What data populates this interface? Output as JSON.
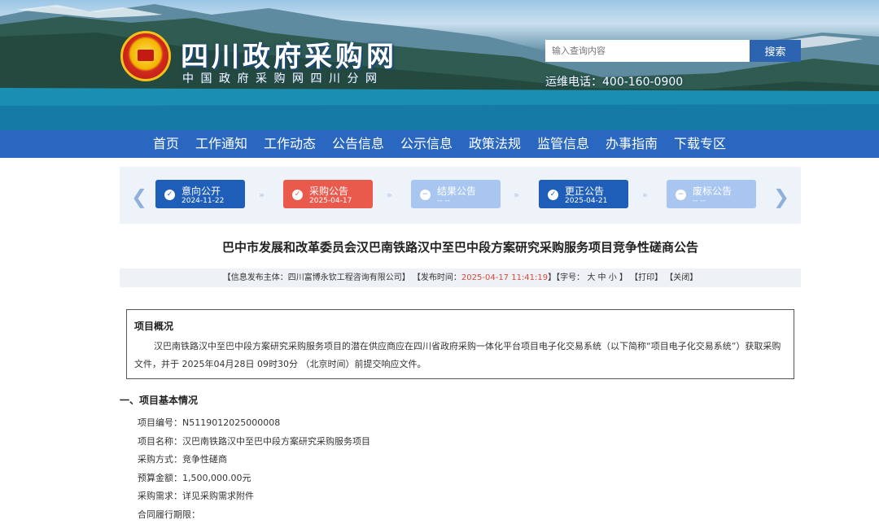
{
  "header": {
    "title": "四川政府采购网",
    "subtitle": "中国政府采购网四川分网",
    "search_placeholder": "输入查询内容",
    "search_button": "搜索",
    "hotline": "运维电话：400-160-0900"
  },
  "nav": {
    "items": [
      "首页",
      "工作通知",
      "工作动态",
      "公告信息",
      "公示信息",
      "政策法规",
      "监管信息",
      "办事指南",
      "下载专区"
    ]
  },
  "timeline": {
    "steps": [
      {
        "label": "意向公开",
        "date": "2024-11-22",
        "state": "done",
        "color": "#1f5eb8",
        "icon": "check-icon"
      },
      {
        "label": "采购公告",
        "date": "2025-04-17",
        "state": "current",
        "color": "#ea5a4c",
        "icon": "check-icon"
      },
      {
        "label": "结果公告",
        "date": "-- --",
        "state": "pending",
        "color": "#a8c6f0",
        "icon": "minus-icon"
      },
      {
        "label": "更正公告",
        "date": "2025-04-21",
        "state": "done",
        "color": "#1f5eb8",
        "icon": "check-icon"
      },
      {
        "label": "废标公告",
        "date": "-- --",
        "state": "pending",
        "color": "#a8c6f0",
        "icon": "minus-icon"
      }
    ]
  },
  "article": {
    "title": "巴中市发展和改革委员会汉巴南铁路汉中至巴中段方案研究采购服务项目竞争性磋商公告",
    "meta": {
      "publisher_label": "【信息发布主体：",
      "publisher": "四川富博永钦工程咨询有限公司】",
      "time_label": "【发布时间：",
      "time": "2025-04-17 11:41:19",
      "time_end": "】",
      "font_label": "【字号：",
      "font_large": "大",
      "font_medium": "中",
      "font_small": "小",
      "font_end": "】",
      "print": "【打印】",
      "close": "【关闭】"
    },
    "overview": {
      "heading": "项目概况",
      "text": "汉巴南铁路汉中至巴中段方案研究采购服务项目的潜在供应商应在四川省政府采购一体化平台项目电子化交易系统（以下简称“项目电子化交易系统”）获取采购文件，并于 2025年04月28日 09时30分 （北京时间）前提交响应文件。"
    },
    "section1_heading": "一、项目基本情况",
    "basic_info": [
      "项目编号：N5119012025000008",
      "项目名称：汉巴南铁路汉中至巴中段方案研究采购服务项目",
      "采购方式：竞争性磋商",
      "预算金额：1,500,000.00元",
      "采购需求：详见采购需求附件",
      "合同履行期限："
    ]
  }
}
